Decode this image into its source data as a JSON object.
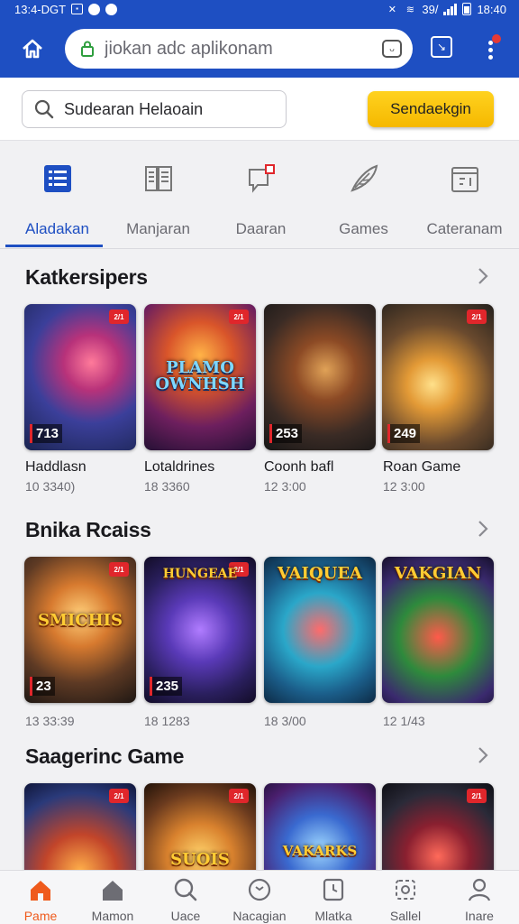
{
  "status_bar": {
    "time_left": "13:4-DGT",
    "left_icons": [
      "box-icon",
      "whatsapp-icon",
      "dot-icon"
    ],
    "right_text": "39/",
    "time_right": "18:40"
  },
  "browser": {
    "url": "jiokan adc aplikonam",
    "secure_icon": "lock-icon"
  },
  "search": {
    "placeholder": "Sudearan Helaoain",
    "button_label": "Sendaekgin"
  },
  "categories": [
    {
      "label": "Aladakan",
      "icon": "list-icon",
      "active": true
    },
    {
      "label": "Manjaran",
      "icon": "book-icon",
      "active": false
    },
    {
      "label": "Daaran",
      "icon": "flag-icon",
      "active": false
    },
    {
      "label": "Games",
      "icon": "feather-icon",
      "active": false
    },
    {
      "label": "Cateranam",
      "icon": "box-icon",
      "active": false
    }
  ],
  "sections": [
    {
      "title": "Katkersipers",
      "cards": [
        {
          "title": "Haddlasn",
          "meta": "10 3340)",
          "badge": "2/1",
          "num": "713",
          "banner": ""
        },
        {
          "title": "Lotaldrines",
          "meta": "18 3360",
          "badge": "2/1",
          "num": "",
          "banner": "PLAMO OWNHSH"
        },
        {
          "title": "Coonh bafl",
          "meta": "12 3:00",
          "badge": "",
          "num": "253",
          "banner": ""
        },
        {
          "title": "Roan Game",
          "meta": "12 3:00",
          "badge": "2/1",
          "num": "249",
          "banner": ""
        }
      ]
    },
    {
      "title": "Bnika Rcaiss",
      "cards": [
        {
          "title": "",
          "meta": "13 33:39",
          "badge": "2/1",
          "num": "23",
          "banner": "SMICHIS"
        },
        {
          "title": "",
          "meta": "18 1283",
          "badge": "2/1",
          "num": "235",
          "banner": "HUNGEAE"
        },
        {
          "title": "",
          "meta": "18 3/00",
          "badge": "",
          "num": "",
          "banner": "VAIQUEA"
        },
        {
          "title": "",
          "meta": "12 1/43",
          "badge": "",
          "num": "",
          "banner": "VAKGIAN"
        }
      ]
    },
    {
      "title": "Saagerinc Game",
      "cards": [
        {
          "title": "",
          "meta": "",
          "badge": "2/1",
          "num": "",
          "banner": ""
        },
        {
          "title": "",
          "meta": "",
          "badge": "2/1",
          "num": "",
          "banner": "SUOIS"
        },
        {
          "title": "",
          "meta": "",
          "badge": "",
          "num": "",
          "banner": "VAKARKS"
        },
        {
          "title": "",
          "meta": "",
          "badge": "2/1",
          "num": "",
          "banner": ""
        }
      ]
    }
  ],
  "bottom_nav": [
    {
      "label": "Pame",
      "icon": "home-icon",
      "active": true
    },
    {
      "label": "Mamon",
      "icon": "house-icon",
      "active": false
    },
    {
      "label": "Uace",
      "icon": "search-icon",
      "active": false
    },
    {
      "label": "Nacagian",
      "icon": "compass-icon",
      "active": false
    },
    {
      "label": "Mlatka",
      "icon": "clock-icon",
      "active": false
    },
    {
      "label": "Sallel",
      "icon": "grid-icon",
      "active": false
    },
    {
      "label": "Inare",
      "icon": "person-icon",
      "active": false
    }
  ],
  "colors": {
    "brand_blue": "#1e4fc2",
    "accent_yellow": "#f5b800",
    "active_orange": "#ef5a1c",
    "badge_red": "#e0262b"
  }
}
